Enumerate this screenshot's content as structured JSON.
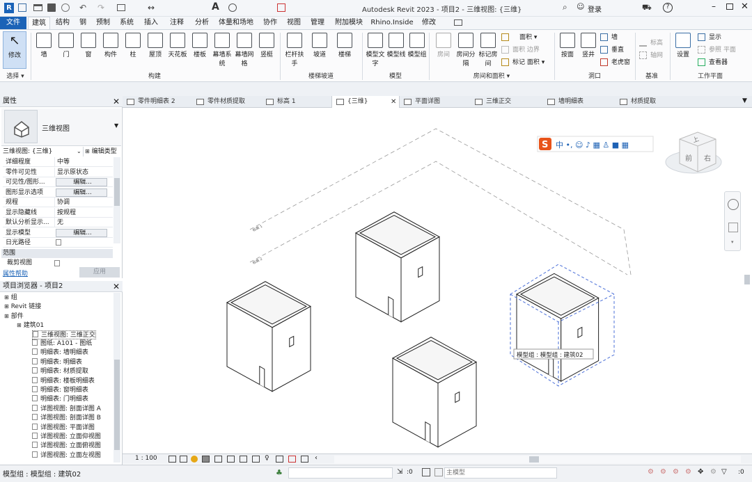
{
  "app": {
    "title": "Autodesk Revit 2023 - 项目2 - 三维视图: {三维}",
    "search_label": "登录",
    "help_label": "?"
  },
  "ribbon_tabs": [
    "文件",
    "建筑",
    "结构",
    "钢",
    "预制",
    "系统",
    "插入",
    "注释",
    "分析",
    "体量和场地",
    "协作",
    "视图",
    "管理",
    "附加模块",
    "Rhino.Inside",
    "修改"
  ],
  "ribbon": {
    "modify": "修改",
    "select_label": "选择 ▾",
    "build_buttons": [
      "墙",
      "门",
      "窗",
      "构件",
      "柱",
      "屋顶",
      "天花板",
      "楼板",
      "幕墙系统",
      "幕墙网格",
      "竖梃"
    ],
    "build_label": "构建",
    "stair_buttons": [
      "栏杆扶手",
      "坡道",
      "楼梯"
    ],
    "stair_label": "楼梯坡道",
    "model_buttons": [
      "模型文字",
      "模型线",
      "模型组"
    ],
    "model_label": "模型",
    "room_buttons": [
      "房间",
      "房间分隔",
      "标记房间"
    ],
    "room_small": [
      "面积 ▾",
      "面积 边界",
      "标记 面积 ▾"
    ],
    "room_label": "房间和面积 ▾",
    "opening_buttons": [
      "按面",
      "竖井"
    ],
    "opening_small": [
      "墙",
      "垂直",
      "老虎窗"
    ],
    "opening_label": "洞口",
    "datum_small": [
      "标高",
      "轴网"
    ],
    "datum_label": "基准",
    "workplane_buttons": [
      "设置"
    ],
    "workplane_small": [
      "显示",
      "参照 平面",
      "查看器"
    ],
    "workplane_label": "工作平面"
  },
  "properties": {
    "title": "属性",
    "type_name": "三维视图",
    "instance_select": "三维视图: {三维}",
    "edit_type": "编辑类型",
    "rows": [
      {
        "k": "详细程度",
        "v": "中等"
      },
      {
        "k": "零件可见性",
        "v": "显示原状态"
      },
      {
        "k": "可见性/图形...",
        "v": "编辑..."
      },
      {
        "k": "图形显示选项",
        "v": "编辑..."
      },
      {
        "k": "规程",
        "v": "协调"
      },
      {
        "k": "显示隐藏线",
        "v": "按规程"
      },
      {
        "k": "默认分析显示...",
        "v": "无"
      },
      {
        "k": "显示模型",
        "v": "编辑..."
      },
      {
        "k": "日光路径",
        "v": ""
      }
    ],
    "section": "范围",
    "crop_label": "裁剪视图",
    "help_link": "属性帮助",
    "apply": "应用"
  },
  "browser": {
    "title": "项目浏览器 - 项目2",
    "items": [
      {
        "label": "组",
        "indent": 0
      },
      {
        "label": "Revit 链接",
        "indent": 0
      },
      {
        "label": "部件",
        "indent": 0
      },
      {
        "label": "建筑01",
        "indent": 1
      },
      {
        "label": "三维视图: 三维正交",
        "indent": 2
      },
      {
        "label": "图纸: A101 - 图纸",
        "indent": 2
      },
      {
        "label": "明细表: 墙明细表",
        "indent": 2
      },
      {
        "label": "明细表: 明细表",
        "indent": 2
      },
      {
        "label": "明细表: 材质提取",
        "indent": 2
      },
      {
        "label": "明细表: 楼板明细表",
        "indent": 2
      },
      {
        "label": "明细表: 窗明细表",
        "indent": 2
      },
      {
        "label": "明细表: 门明细表",
        "indent": 2
      },
      {
        "label": "详图视图: 剖面详图 A",
        "indent": 2
      },
      {
        "label": "详图视图: 剖面详图 B",
        "indent": 2
      },
      {
        "label": "详图视图: 平面详图",
        "indent": 2
      },
      {
        "label": "详图视图: 立面仰视图",
        "indent": 2
      },
      {
        "label": "详图视图: 立面俯视图",
        "indent": 2
      },
      {
        "label": "详图视图: 立面左视图",
        "indent": 2
      }
    ]
  },
  "view_tabs": [
    "零件明细表 2",
    "零件材质提取",
    "标高 1",
    "{三维}",
    "平面详图",
    "三维正交",
    "墙明细表",
    "材质提取"
  ],
  "active_view_tab": "{三维}",
  "canvas": {
    "tooltip": "模型组 : 模型组 : 建筑02",
    "viewcube_top": "上",
    "viewcube_front": "前",
    "viewcube_right": "右"
  },
  "viewbar": {
    "scale": "1 : 100"
  },
  "status": {
    "text": "模型组 : 模型组 : 建筑02",
    "zero": ":0",
    "model_dropdown": "主模型",
    "filter_count": ":0"
  }
}
